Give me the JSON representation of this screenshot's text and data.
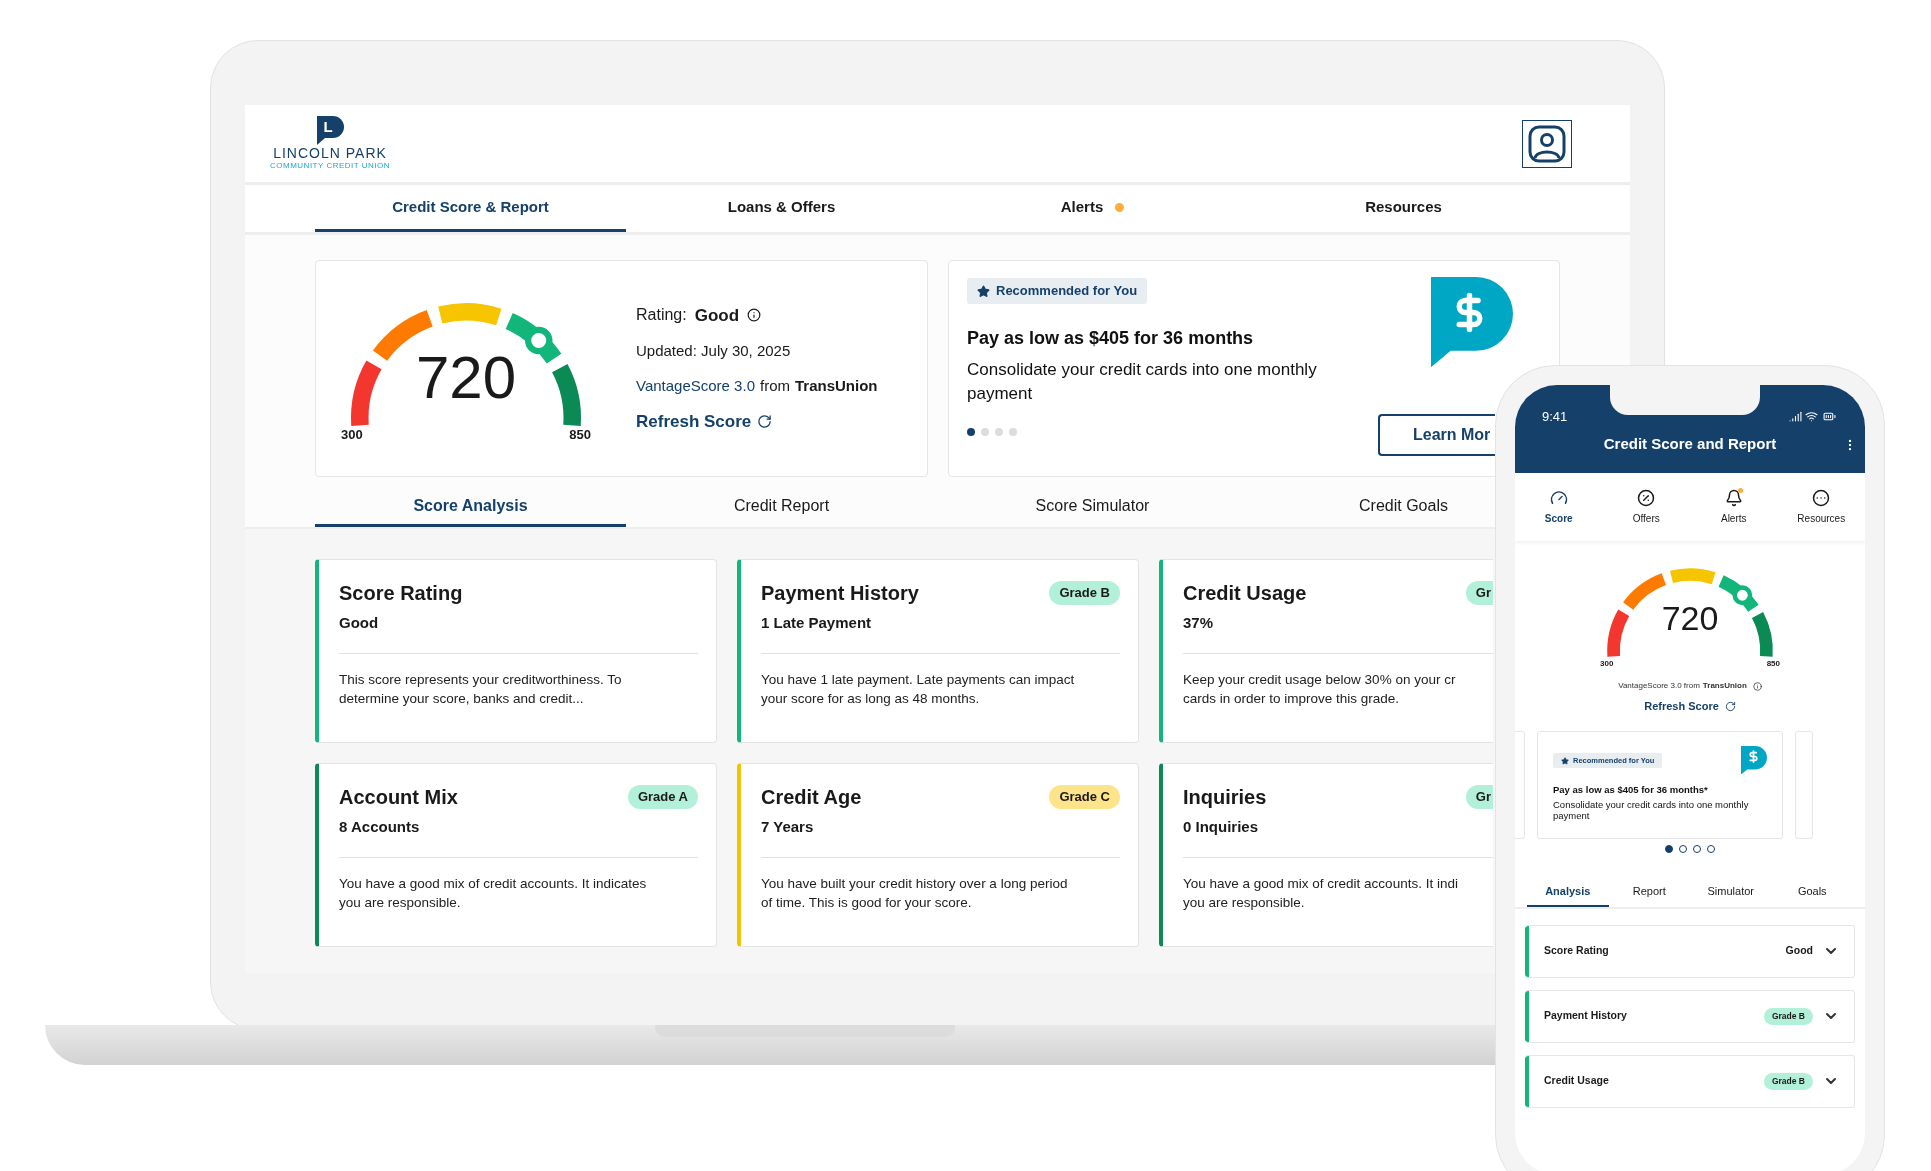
{
  "laptop": {
    "logo": {
      "mark": "L",
      "name": "LINCOLN PARK",
      "tagline": "COMMUNITY CREDIT UNION"
    },
    "nav_tabs": [
      {
        "label": "Credit Score & Report",
        "selected": true,
        "notification": false
      },
      {
        "label": "Loans & Offers",
        "selected": false,
        "notification": false
      },
      {
        "label": "Alerts",
        "selected": false,
        "notification": true
      },
      {
        "label": "Resources",
        "selected": false,
        "notification": false
      }
    ],
    "score_card": {
      "score": "720",
      "min": "300",
      "max": "850",
      "rating_label": "Rating:",
      "rating": "Good",
      "updated": "Updated: July 30, 2025",
      "model": "VantageScore 3.0",
      "from": "from",
      "bureau": "TransUnion",
      "refresh": "Refresh Score"
    },
    "recommendation": {
      "tag": "Recommended for You",
      "title": "Pay as low as $405 for 36 months",
      "description": "Consolidate your credit cards into one monthly payment",
      "button": "Learn Mor",
      "dots": [
        {
          "selected": true
        },
        {
          "selected": false
        },
        {
          "selected": false
        },
        {
          "selected": false
        }
      ]
    },
    "sub_tabs": [
      {
        "label": "Score Analysis",
        "selected": true
      },
      {
        "label": "Credit Report",
        "selected": false
      },
      {
        "label": "Score Simulator",
        "selected": false
      },
      {
        "label": "Credit Goals",
        "selected": false
      }
    ],
    "factor_cards": [
      {
        "title": "Score Rating",
        "value": "Good",
        "color": "#12b57a",
        "clipped": false,
        "lines": [
          "This score represents your creditworthiness. To",
          "determine your score, banks and credit..."
        ]
      },
      {
        "title": "Payment History",
        "value": "1 Late Payment",
        "color": "#12b57a",
        "clipped": false,
        "badge": {
          "text": "Grade B",
          "color": "#b3f0d9"
        },
        "lines": [
          "You have 1 late payment. Late payments can impact",
          "your score for as long as 48 months."
        ]
      },
      {
        "title": "Credit Usage",
        "value": "37%",
        "color": "#12b57a",
        "clipped": true,
        "badge": {
          "text": "Gr",
          "color": "#b3f0d9"
        },
        "lines": [
          "Keep your credit usage below 30% on your cr",
          "cards in order to improve this grade."
        ]
      },
      {
        "title": "Account Mix",
        "value": "8 Accounts",
        "color": "#0b8a55",
        "clipped": false,
        "badge": {
          "text": "Grade A",
          "color": "#b3f0d9"
        },
        "lines": [
          "You have a good mix of credit accounts. It indicates",
          "you are responsible."
        ]
      },
      {
        "title": "Credit Age",
        "value": "7 Years",
        "color": "#f5c400",
        "clipped": false,
        "badge": {
          "text": "Grade C",
          "color": "#fde38a"
        },
        "lines": [
          "You have built your credit history over a long period",
          "of time. This is good for your score."
        ]
      },
      {
        "title": "Inquiries",
        "value": "0 Inquiries",
        "color": "#0b8a55",
        "clipped": true,
        "badge": {
          "text": "Gr",
          "color": "#b3f0d9"
        },
        "lines": [
          "You have a good mix of credit accounts. It indi",
          "you are responsible."
        ]
      }
    ]
  },
  "phone": {
    "time": "9:41",
    "title": "Credit Score and Report",
    "nav": [
      {
        "label": "Score",
        "selected": true,
        "notification": false
      },
      {
        "label": "Offers",
        "selected": false,
        "notification": false
      },
      {
        "label": "Alerts",
        "selected": false,
        "notification": true
      },
      {
        "label": "Resources",
        "selected": false,
        "notification": false
      }
    ],
    "score": "720",
    "min": "300",
    "max": "850",
    "model": "VantageScore 3.0 from",
    "bureau": "TransUnion",
    "refresh": "Refresh Score",
    "recommendation": {
      "tag": "Recommended for You",
      "title": "Pay as low as $405 for 36 months*",
      "description": "Consolidate your credit cards into one monthly payment",
      "dots": [
        {
          "selected": true
        },
        {
          "selected": false
        },
        {
          "selected": false
        },
        {
          "selected": false
        }
      ]
    },
    "tabs": [
      {
        "label": "Analysis",
        "selected": true
      },
      {
        "label": "Report",
        "selected": false
      },
      {
        "label": "Simulator",
        "selected": false
      },
      {
        "label": "Goals",
        "selected": false
      }
    ],
    "rows": [
      {
        "kind": "text",
        "label": "Score Rating",
        "value": "Good",
        "color": "#12b57a"
      },
      {
        "kind": "badge",
        "label": "Payment History",
        "value": "Grade B",
        "color": "#12b57a"
      },
      {
        "kind": "badge",
        "label": "Credit Usage",
        "value": "Grade B",
        "color": "#12b57a"
      }
    ]
  }
}
